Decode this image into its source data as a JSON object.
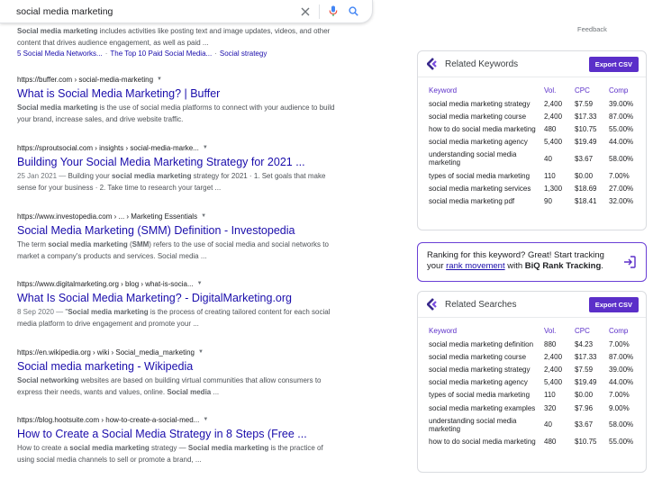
{
  "search": {
    "query": "social media marketing"
  },
  "feedback_label": "Feedback",
  "results": [
    {
      "snippet_html": "<b>Social media marketing</b> includes activities like posting text and image updates, videos, and other content that drives audience engagement, as well as paid ...",
      "sitelinks": [
        "5 Social Media Networks...",
        "The Top 10 Paid Social Media...",
        "Social strategy"
      ]
    },
    {
      "cite": "https://buffer.com › social-media-marketing",
      "title": "What is Social Media Marketing? | Buffer",
      "snippet_html": "<b>Social media marketing</b> is the use of social media platforms to connect with your audience to build your brand, increase sales, and drive website traffic."
    },
    {
      "cite": "https://sproutsocial.com › insights › social-media-marke...",
      "title": "Building Your Social Media Marketing Strategy for 2021 ...",
      "snippet_html": "<span class=\"date\">25 Jan 2021 — </span>Building your <b>social media marketing</b> strategy for 2021 · 1. Set goals that make sense for your business · 2. Take time to research your target ..."
    },
    {
      "cite": "https://www.investopedia.com › ... › Marketing Essentials",
      "title": "Social Media Marketing (SMM) Definition - Investopedia",
      "snippet_html": "The term <b>social media marketing</b> (<b>SMM</b>) refers to the use of social media and social networks to market a company's products and services. Social media ..."
    },
    {
      "cite": "https://www.digitalmarketing.org › blog › what-is-socia...",
      "title": "What Is Social Media Marketing? - DigitalMarketing.org",
      "snippet_html": "<span class=\"date\">8 Sep 2020 — </span>\"<b>Social media marketing</b> is the process of creating tailored content for each social media platform to drive engagement and promote your ..."
    },
    {
      "cite": "https://en.wikipedia.org › wiki › Social_media_marketing",
      "title": "Social media marketing - Wikipedia",
      "snippet_html": "<b>Social networking</b> websites are based on building virtual communities that allow consumers to express their needs, wants and values, online. <b>Social media</b> ..."
    },
    {
      "cite": "https://blog.hootsuite.com › how-to-create-a-social-med...",
      "title": "How to Create a Social Media Strategy in 8 Steps (Free ...",
      "snippet_html": "How to create a <b>social media marketing</b> strategy — <b>Social media marketing</b> is the practice of using social media channels to sell or promote a brand, ..."
    }
  ],
  "related_keywords": {
    "title": "Related Keywords",
    "export_label": "Export CSV",
    "columns": [
      "Keyword",
      "Vol.",
      "CPC",
      "Comp"
    ],
    "rows": [
      [
        "social media marketing strategy",
        "2,400",
        "$7.59",
        "39.00%"
      ],
      [
        "social media marketing course",
        "2,400",
        "$17.33",
        "87.00%"
      ],
      [
        "how to do social media marketing",
        "480",
        "$10.75",
        "55.00%"
      ],
      [
        "social media marketing agency",
        "5,400",
        "$19.49",
        "44.00%"
      ],
      [
        "understanding social media marketing",
        "40",
        "$3.67",
        "58.00%"
      ],
      [
        "types of social media marketing",
        "110",
        "$0.00",
        "7.00%"
      ],
      [
        "social media marketing services",
        "1,300",
        "$18.69",
        "27.00%"
      ],
      [
        "social media marketing pdf",
        "90",
        "$18.41",
        "32.00%"
      ]
    ]
  },
  "promo": {
    "text_1": "Ranking for this keyword? Great! Start tracking your ",
    "link": "rank movement",
    "text_2": " with ",
    "brand": "BiQ Rank Tracking",
    "text_3": "."
  },
  "related_searches": {
    "title": "Related Searches",
    "export_label": "Export CSV",
    "columns": [
      "Keyword",
      "Vol.",
      "CPC",
      "Comp"
    ],
    "rows": [
      [
        "social media marketing definition",
        "880",
        "$4.23",
        "7.00%"
      ],
      [
        "social media marketing course",
        "2,400",
        "$17.33",
        "87.00%"
      ],
      [
        "social media marketing strategy",
        "2,400",
        "$7.59",
        "39.00%"
      ],
      [
        "social media marketing agency",
        "5,400",
        "$19.49",
        "44.00%"
      ],
      [
        "types of social media marketing",
        "110",
        "$0.00",
        "7.00%"
      ],
      [
        "social media marketing examples",
        "320",
        "$7.96",
        "9.00%"
      ],
      [
        "understanding social media marketing",
        "40",
        "$3.67",
        "58.00%"
      ],
      [
        "how to do social media marketing",
        "480",
        "$10.75",
        "55.00%"
      ]
    ]
  },
  "colors": {
    "link": "#1a0dab",
    "accent": "#5b2fc9",
    "mic_blue": "#4285f4",
    "mic_red": "#ea4335"
  }
}
